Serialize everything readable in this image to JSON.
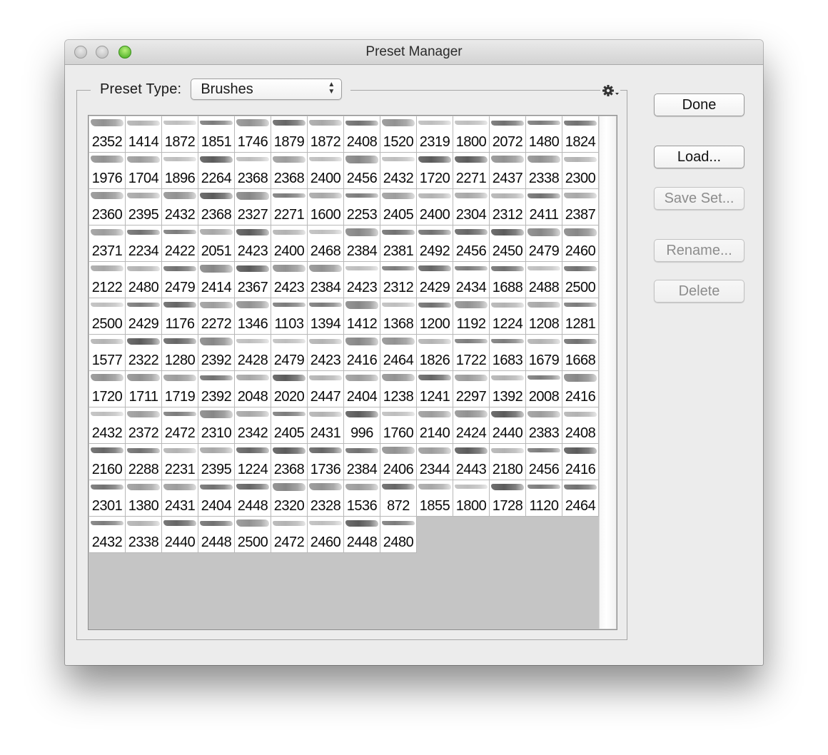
{
  "window": {
    "title": "Preset Manager"
  },
  "preset": {
    "type_label": "Preset Type:",
    "selected": "Brushes",
    "gear_icon": "gear-icon"
  },
  "buttons": {
    "done": "Done",
    "load": "Load...",
    "save_set": "Save Set...",
    "rename": "Rename...",
    "delete": "Delete"
  },
  "brushes": [
    "2352",
    "1414",
    "1872",
    "1851",
    "1746",
    "1879",
    "1872",
    "2408",
    "1520",
    "2319",
    "1800",
    "2072",
    "1480",
    "1824",
    "1976",
    "1704",
    "1896",
    "2264",
    "2368",
    "2368",
    "2400",
    "2456",
    "2432",
    "1720",
    "2271",
    "2437",
    "2338",
    "2300",
    "2360",
    "2395",
    "2432",
    "2368",
    "2327",
    "2271",
    "1600",
    "2253",
    "2405",
    "2400",
    "2304",
    "2312",
    "2411",
    "2387",
    "2371",
    "2234",
    "2422",
    "2051",
    "2423",
    "2400",
    "2468",
    "2384",
    "2381",
    "2492",
    "2456",
    "2450",
    "2479",
    "2460",
    "2122",
    "2480",
    "2479",
    "2414",
    "2367",
    "2423",
    "2384",
    "2423",
    "2312",
    "2429",
    "2434",
    "1688",
    "2488",
    "2500",
    "2500",
    "2429",
    "1176",
    "2272",
    "1346",
    "1103",
    "1394",
    "1412",
    "1368",
    "1200",
    "1192",
    "1224",
    "1208",
    "1281",
    "1577",
    "2322",
    "1280",
    "2392",
    "2428",
    "2479",
    "2423",
    "2416",
    "2464",
    "1826",
    "1722",
    "1683",
    "1679",
    "1668",
    "1720",
    "1711",
    "1719",
    "2392",
    "2048",
    "2020",
    "2447",
    "2404",
    "1238",
    "1241",
    "2297",
    "1392",
    "2008",
    "2416",
    "2432",
    "2372",
    "2472",
    "2310",
    "2342",
    "2405",
    "2431",
    "996",
    "1760",
    "2140",
    "2424",
    "2440",
    "2383",
    "2408",
    "2160",
    "2288",
    "2231",
    "2395",
    "1224",
    "2368",
    "1736",
    "2384",
    "2406",
    "2344",
    "2443",
    "2180",
    "2456",
    "2416",
    "2301",
    "1380",
    "2431",
    "2404",
    "2448",
    "2320",
    "2328",
    "1536",
    "872",
    "1855",
    "1800",
    "1728",
    "1120",
    "2464",
    "2432",
    "2338",
    "2440",
    "2448",
    "2500",
    "2472",
    "2460",
    "2448",
    "2480"
  ]
}
